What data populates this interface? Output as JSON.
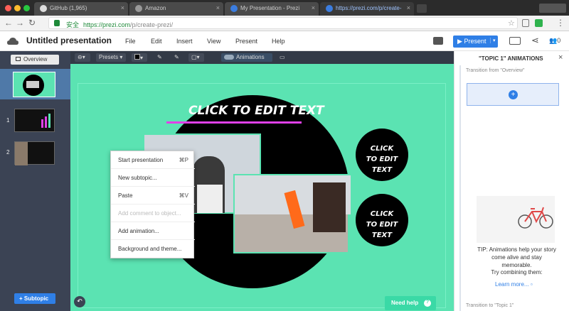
{
  "browser": {
    "tabs": [
      {
        "label": "GitHub (1,965)"
      },
      {
        "label": "Amazon"
      },
      {
        "label": "My Presentation - Prezi"
      },
      {
        "label": "https://prezi.com/p/create-"
      }
    ],
    "url_secure": "安全",
    "url_host": "https://prezi.com",
    "url_path": "/p/create-prezi/"
  },
  "header": {
    "title": "Untitled presentation",
    "menu": [
      "File",
      "Edit",
      "Insert",
      "View",
      "Present",
      "Help"
    ],
    "present_label": "Present",
    "collab_count": "0"
  },
  "left": {
    "overview_label": "Overview",
    "slides": [
      {
        "num": "1"
      },
      {
        "num": "2"
      }
    ],
    "subtopic_label": "Subtopic"
  },
  "toolbar": {
    "presets_label": "Presets",
    "animations_label": "Animations"
  },
  "canvas": {
    "main_title": "CLICK TO EDIT TEXT",
    "circle_text_1": "CLICK TO EDIT TEXT",
    "circle_text_2": "CLICK TO EDIT TEXT",
    "need_help": "Need help"
  },
  "context_menu": {
    "items": [
      {
        "label": "Start presentation",
        "shortcut": "⌘P"
      },
      {
        "label": "New subtopic...",
        "shortcut": ""
      },
      {
        "label": "Paste",
        "shortcut": "⌘V"
      },
      {
        "label": "Add comment to object...",
        "shortcut": ""
      },
      {
        "label": "Add animation...",
        "shortcut": ""
      },
      {
        "label": "Background and theme...",
        "shortcut": ""
      }
    ]
  },
  "right": {
    "title": "\"TOPIC 1\" ANIMATIONS",
    "transition_from": "Transition from \"Overview\"",
    "tip": "TIP: Animations help your story come alive and stay memorable.",
    "tip2": "Try combining them:",
    "learn_more": "Learn more...",
    "transition_to": "Transition to \"Topic 1\""
  },
  "colors": {
    "canvas_bg": "#5be3b2",
    "accent_blue": "#2f7fe6",
    "magenta": "#e040e8"
  }
}
